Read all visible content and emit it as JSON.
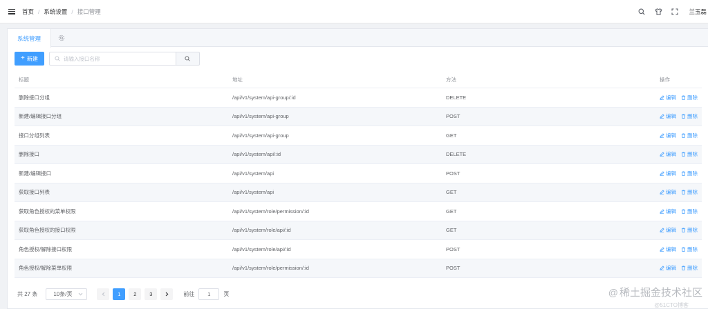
{
  "breadcrumb": [
    "首页",
    "系统设置",
    "接口管理"
  ],
  "header": {
    "username": "兰玉磊"
  },
  "tabs": [
    {
      "label": "系统管理",
      "active": true
    },
    {
      "icon": "gear-icon"
    }
  ],
  "toolbar": {
    "new_label": "新建",
    "search_placeholder": "请输入接口名称"
  },
  "table": {
    "columns": [
      "标题",
      "地址",
      "方法",
      "操作"
    ],
    "action_edit": "编辑",
    "action_delete": "删除",
    "rows": [
      {
        "title": "删除接口分组",
        "path": "/api/v1/system/api-group/:id",
        "method": "DELETE"
      },
      {
        "title": "新建/编辑接口分组",
        "path": "/api/v1/system/api-group",
        "method": "POST"
      },
      {
        "title": "接口分组列表",
        "path": "/api/v1/system/api-group",
        "method": "GET"
      },
      {
        "title": "删除接口",
        "path": "/api/v1/system/api/:id",
        "method": "DELETE"
      },
      {
        "title": "新建/编辑接口",
        "path": "/api/v1/system/api",
        "method": "POST"
      },
      {
        "title": "获取接口列表",
        "path": "/api/v1/system/api",
        "method": "GET"
      },
      {
        "title": "获取角色授权的菜单权限",
        "path": "/api/v1/system/role/permission/:id",
        "method": "GET"
      },
      {
        "title": "获取角色授权的接口权限",
        "path": "/api/v1/system/role/api/:id",
        "method": "GET"
      },
      {
        "title": "角色授权/解除接口权限",
        "path": "/api/v1/system/role/api/:id",
        "method": "POST"
      },
      {
        "title": "角色授权/解除菜单权限",
        "path": "/api/v1/system/role/permission/:id",
        "method": "POST"
      }
    ]
  },
  "pagination": {
    "total": "共 27 条",
    "page_size": "10条/页",
    "pages": [
      "1",
      "2",
      "3"
    ],
    "current": "1",
    "goto_label": "前往",
    "goto_value": "1",
    "goto_suffix": "页"
  },
  "watermark": {
    "text": "稀土掘金技术社区",
    "sub": "@51CTO博客"
  },
  "colors": {
    "primary": "#409eff",
    "text": "#606266",
    "muted": "#909399",
    "row_highlight": "#f5f7fa"
  }
}
